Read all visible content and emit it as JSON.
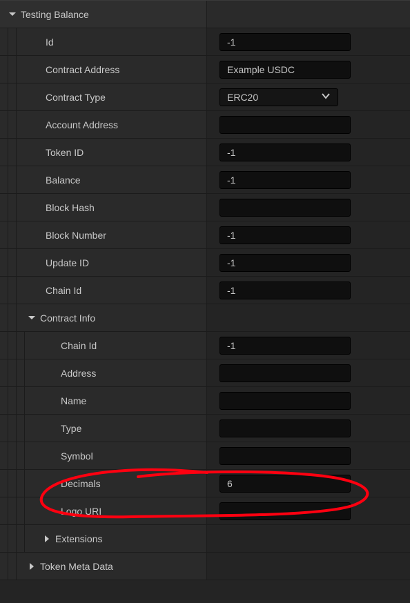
{
  "section": {
    "title": "Testing Balance"
  },
  "fields": {
    "id": {
      "label": "Id",
      "value": "-1"
    },
    "contractAddress": {
      "label": "Contract Address",
      "value": "Example USDC"
    },
    "contractType": {
      "label": "Contract Type",
      "value": "ERC20"
    },
    "accountAddress": {
      "label": "Account Address",
      "value": ""
    },
    "tokenId": {
      "label": "Token ID",
      "value": "-1"
    },
    "balance": {
      "label": "Balance",
      "value": "-1"
    },
    "blockHash": {
      "label": "Block Hash",
      "value": ""
    },
    "blockNumber": {
      "label": "Block Number",
      "value": "-1"
    },
    "updateId": {
      "label": "Update ID",
      "value": "-1"
    },
    "chainId": {
      "label": "Chain Id",
      "value": "-1"
    }
  },
  "contractInfo": {
    "title": "Contract Info",
    "fields": {
      "chainId": {
        "label": "Chain Id",
        "value": "-1"
      },
      "address": {
        "label": "Address",
        "value": ""
      },
      "name": {
        "label": "Name",
        "value": ""
      },
      "type": {
        "label": "Type",
        "value": ""
      },
      "symbol": {
        "label": "Symbol",
        "value": ""
      },
      "decimals": {
        "label": "Decimals",
        "value": "6"
      },
      "logoUri": {
        "label": "Logo URI",
        "value": ""
      }
    },
    "extensions": {
      "label": "Extensions"
    }
  },
  "tokenMetaData": {
    "label": "Token Meta Data"
  },
  "annotation": {
    "color": "#ff0010",
    "target": "decimals-row"
  }
}
